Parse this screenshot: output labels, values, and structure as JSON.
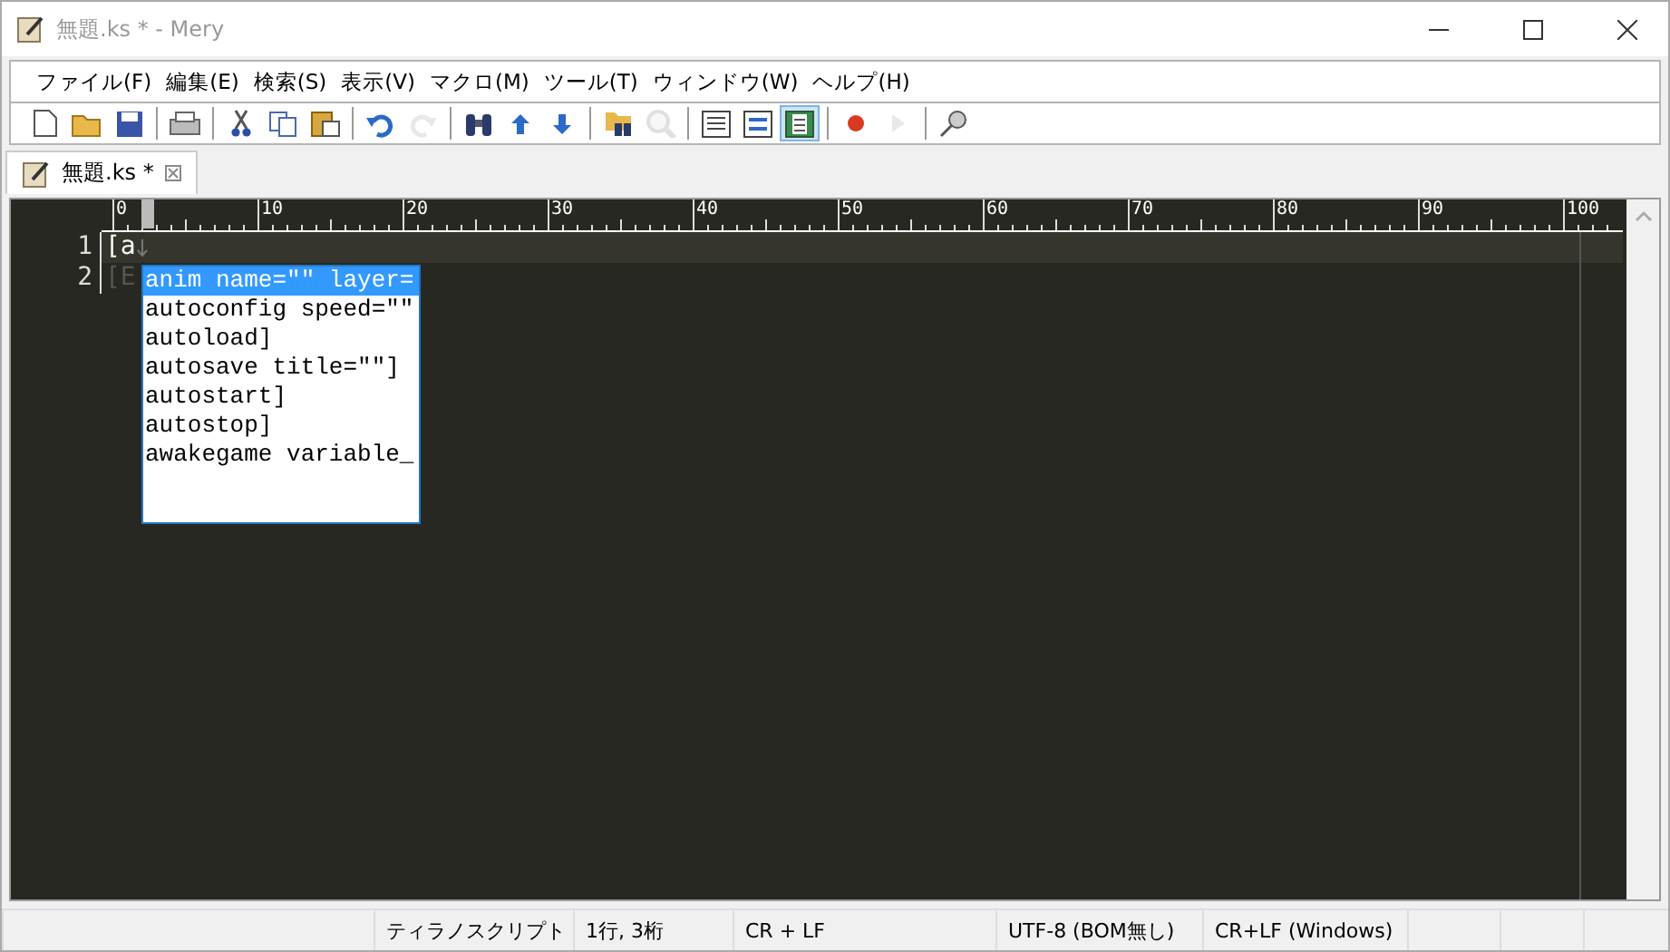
{
  "window": {
    "title": "無題.ks * - Mery",
    "active": false
  },
  "menu": [
    "ファイル(F)",
    "編集(E)",
    "検索(S)",
    "表示(V)",
    "マクロ(M)",
    "ツール(T)",
    "ウィンドウ(W)",
    "ヘルプ(H)"
  ],
  "toolbar": [
    {
      "kind": "new",
      "disabled": false,
      "pressed": false
    },
    {
      "kind": "open",
      "disabled": false,
      "pressed": false
    },
    {
      "kind": "save",
      "disabled": false,
      "pressed": false
    },
    {
      "kind": "sep"
    },
    {
      "kind": "print",
      "disabled": false,
      "pressed": false
    },
    {
      "kind": "sep"
    },
    {
      "kind": "cut",
      "disabled": false,
      "pressed": false
    },
    {
      "kind": "copy",
      "disabled": false,
      "pressed": false
    },
    {
      "kind": "paste",
      "disabled": false,
      "pressed": false
    },
    {
      "kind": "sep"
    },
    {
      "kind": "undo",
      "disabled": false,
      "pressed": false
    },
    {
      "kind": "redo",
      "disabled": true,
      "pressed": false
    },
    {
      "kind": "sep"
    },
    {
      "kind": "find",
      "disabled": false,
      "pressed": false
    },
    {
      "kind": "up",
      "disabled": false,
      "pressed": false
    },
    {
      "kind": "down",
      "disabled": false,
      "pressed": false
    },
    {
      "kind": "sep"
    },
    {
      "kind": "findfiles",
      "disabled": false,
      "pressed": false
    },
    {
      "kind": "magnifier",
      "disabled": true,
      "pressed": false
    },
    {
      "kind": "sep"
    },
    {
      "kind": "view",
      "disabled": false,
      "pressed": false
    },
    {
      "kind": "view2",
      "disabled": false,
      "pressed": false
    },
    {
      "kind": "view3",
      "disabled": false,
      "pressed": true
    },
    {
      "kind": "sep"
    },
    {
      "kind": "record",
      "disabled": false,
      "pressed": false
    },
    {
      "kind": "play",
      "disabled": true,
      "pressed": false
    },
    {
      "kind": "sep"
    },
    {
      "kind": "pin",
      "disabled": false,
      "pressed": false
    }
  ],
  "tabs": [
    {
      "label": "無題.ks *",
      "selected": true
    }
  ],
  "ruler": {
    "labels": [
      "0",
      "10",
      "20",
      "30",
      "40",
      "50",
      "60",
      "70",
      "80",
      "90",
      "100"
    ]
  },
  "lines": [
    {
      "number": "1",
      "text": "[a",
      "current": true
    },
    {
      "number": "2",
      "text": "[E",
      "current": false
    }
  ],
  "autocomplete": [
    {
      "text": "anim name=\"\" layer=",
      "selected": true
    },
    {
      "text": "autoconfig speed=\"\"",
      "selected": false
    },
    {
      "text": "autoload]",
      "selected": false
    },
    {
      "text": "autosave title=\"\"]",
      "selected": false
    },
    {
      "text": "autostart]",
      "selected": false
    },
    {
      "text": "autostop]",
      "selected": false
    },
    {
      "text": "awakegame variable_",
      "selected": false
    }
  ],
  "status_bar": [
    "ティラノスクリプト",
    "1行, 3桁",
    "CR + LF",
    "UTF-8 (BOM無し)",
    "CR+LF (Windows)"
  ]
}
